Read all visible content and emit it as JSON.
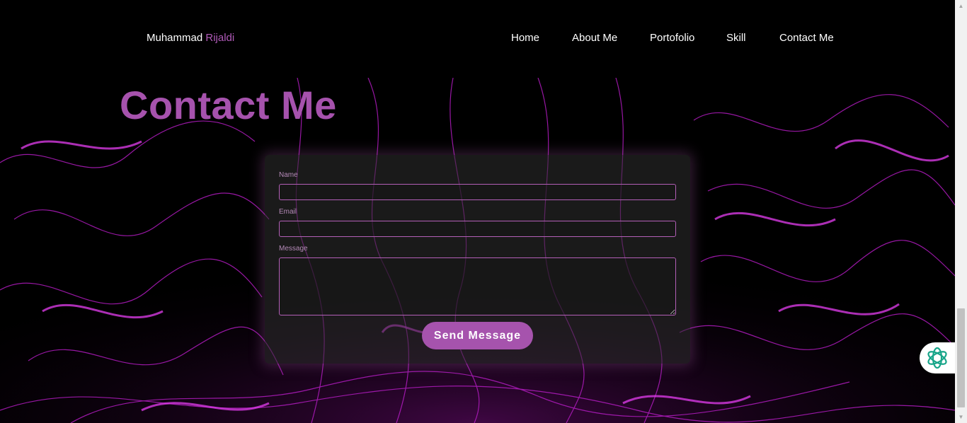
{
  "brand": {
    "first": "Muhammad",
    "last": "Rijaldi"
  },
  "nav": [
    {
      "label": "Home"
    },
    {
      "label": "About Me"
    },
    {
      "label": "Portofolio"
    },
    {
      "label": "Skill"
    },
    {
      "label": "Contact Me"
    }
  ],
  "page_title": "Contact Me",
  "form": {
    "name_label": "Name",
    "name_value": "",
    "email_label": "Email",
    "email_value": "",
    "message_label": "Message",
    "message_value": "",
    "submit_label": "Send Message"
  },
  "icons": {
    "assistant": "ai-assistant-icon",
    "scroll_up": "chevron-up-icon",
    "scroll_down": "chevron-down-icon"
  },
  "colors": {
    "accent": "#a653ad",
    "background": "#000000",
    "swirl": "#c21fcf",
    "assistant_icon": "#17a589"
  }
}
